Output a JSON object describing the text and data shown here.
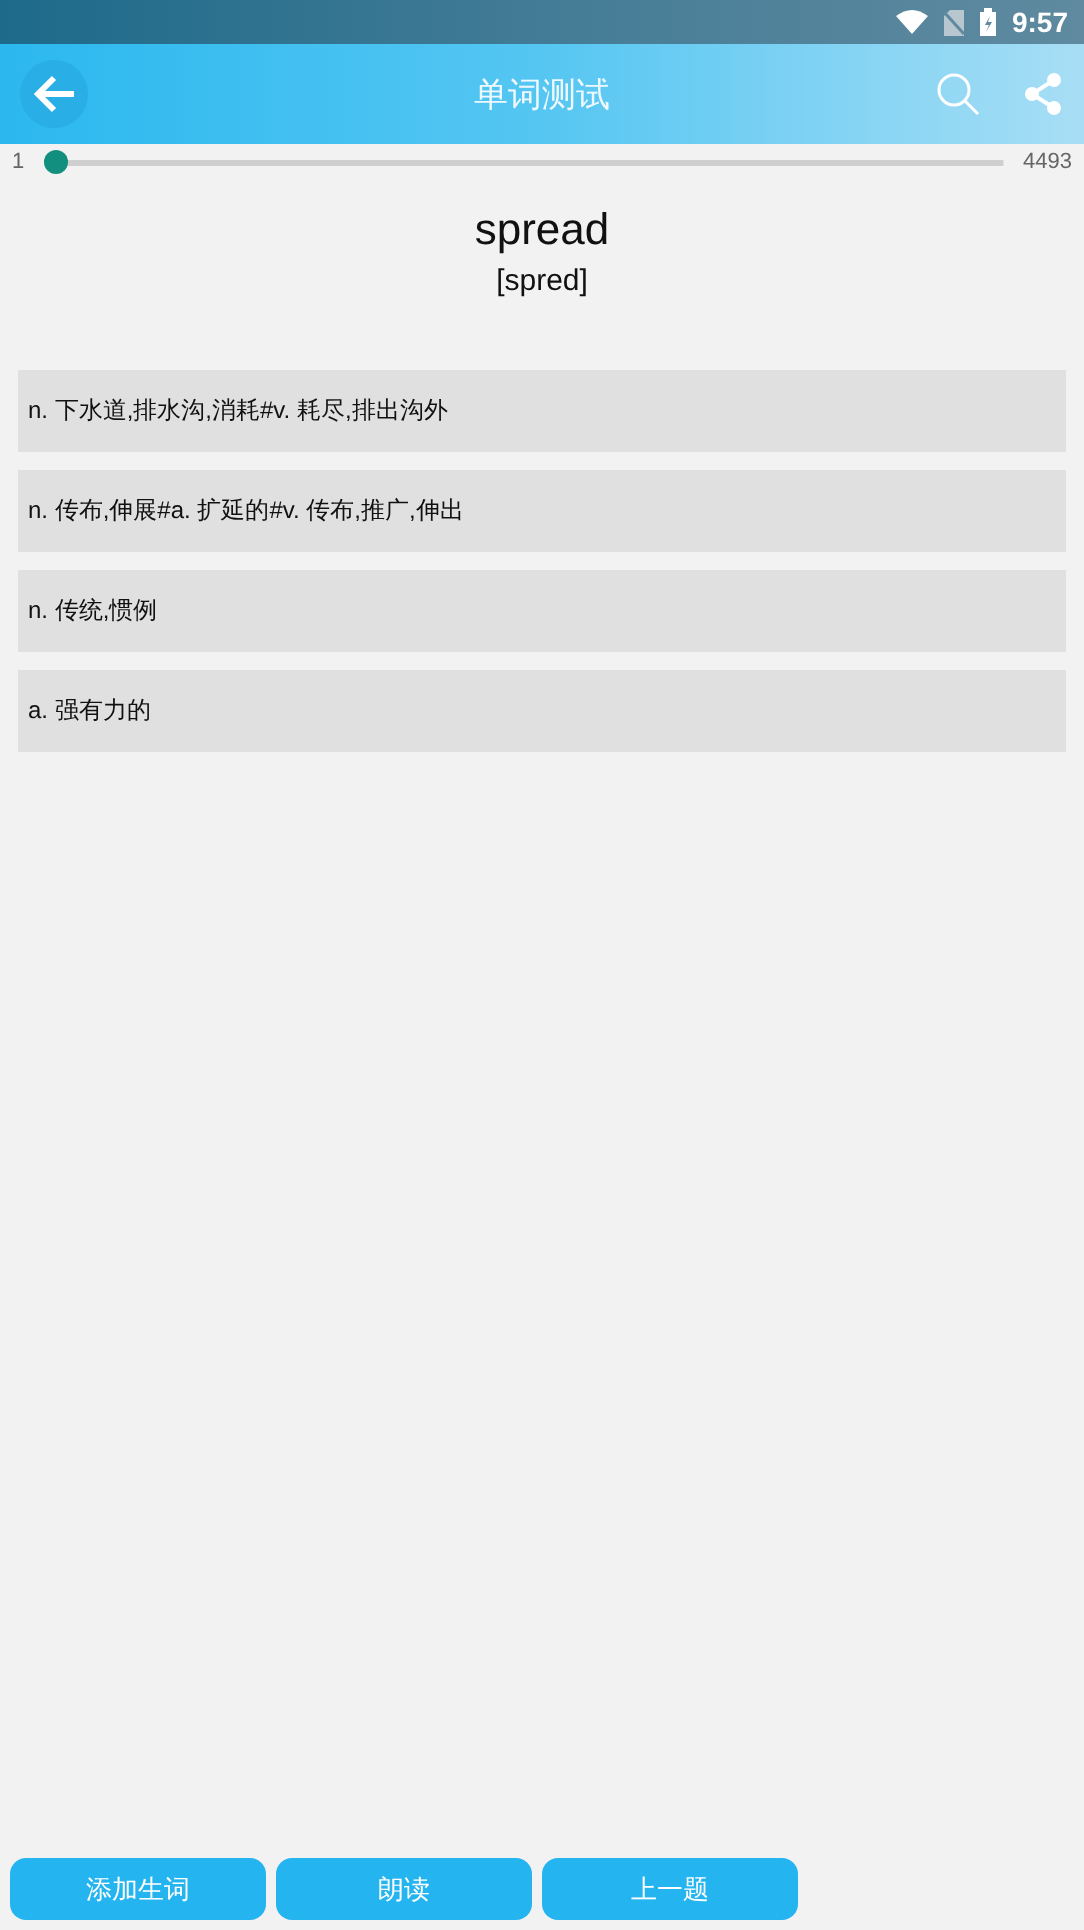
{
  "status_bar": {
    "time": "9:57"
  },
  "app_bar": {
    "title": "单词测试"
  },
  "progress": {
    "start": "1",
    "end": "4493",
    "level": 0.0
  },
  "word": {
    "text": "spread",
    "phonetic": "[spred]"
  },
  "options": [
    {
      "text": "n. 下水道,排水沟,消耗#v. 耗尽,排出沟外"
    },
    {
      "text": "n. 传布,伸展#a. 扩延的#v. 传布,推广,伸出"
    },
    {
      "text": "n. 传统,惯例"
    },
    {
      "text": "a. 强有力的"
    }
  ],
  "buttons": [
    {
      "label": "添加生词"
    },
    {
      "label": "朗读"
    },
    {
      "label": "上一题"
    }
  ]
}
